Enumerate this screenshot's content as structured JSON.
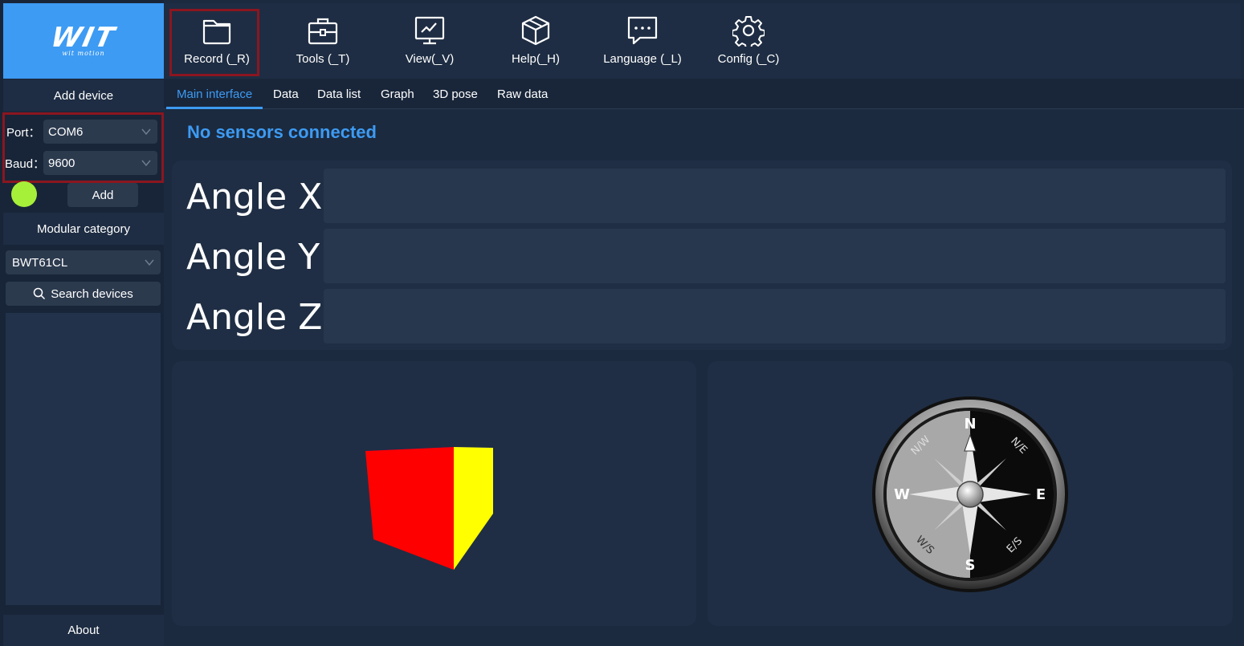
{
  "logo": {
    "brand": "WIT",
    "tagline": "wit motion"
  },
  "toolbar": {
    "items": [
      {
        "label": "Record (_R)",
        "icon": "folder-icon"
      },
      {
        "label": "Tools (_T)",
        "icon": "toolbox-icon"
      },
      {
        "label": "View(_V)",
        "icon": "monitor-chart-icon"
      },
      {
        "label": "Help(_H)",
        "icon": "cube-help-icon"
      },
      {
        "label": "Language (_L)",
        "icon": "chat-bubble-icon"
      },
      {
        "label": "Config (_C)",
        "icon": "gear-icon"
      }
    ]
  },
  "sidebar": {
    "add_device": "Add device",
    "port_label": "Port：",
    "port_value": "COM6",
    "baud_label": "Baud：",
    "baud_value": "9600",
    "add_button": "Add",
    "modular_category": "Modular category",
    "module_value": "BWT61CL",
    "search_devices": "Search devices",
    "about": "About",
    "status_color": "#a6f03a"
  },
  "tabs": [
    "Main interface",
    "Data",
    "Data list",
    "Graph",
    "3D pose",
    "Raw data"
  ],
  "main": {
    "status": "No sensors connected",
    "angle_x": "Angle X",
    "angle_y": "Angle Y",
    "angle_z": "Angle Z"
  },
  "compass": {
    "n": "N",
    "e": "E",
    "s": "S",
    "w": "W",
    "ne": "N/E",
    "nw": "N/W",
    "se": "E/S",
    "sw": "W/S"
  },
  "colors": {
    "accent": "#3d9bf3",
    "highlight_frame": "#8b1620",
    "cube_front": "#ff0000",
    "cube_side": "#ffff00",
    "cube_top": "#0000ff"
  }
}
